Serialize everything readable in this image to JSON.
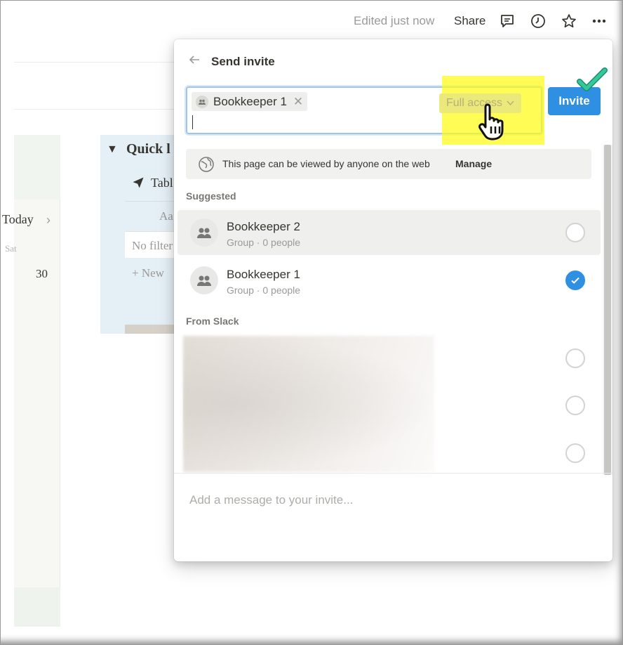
{
  "topbar": {
    "edited_text": "Edited just now",
    "share_label": "Share",
    "icons": [
      "comment-icon",
      "clock-icon",
      "star-icon",
      "more-icon"
    ]
  },
  "background": {
    "calendar": {
      "today_label": "Today",
      "weekday": "Sat",
      "day_number": "30"
    },
    "quick": {
      "title": "Quick l",
      "table_label": "Tabl",
      "property": "Aa",
      "filter_text": "No filter",
      "new_label": "New"
    }
  },
  "popup": {
    "back_icon": "arrow-left-icon",
    "title": "Send invite",
    "chip_label": "Bookkeeper 1",
    "access_label": "Full access",
    "invite_button": "Invite",
    "web_note": "This page can be viewed by anyone on the web",
    "manage_label": "Manage",
    "suggested_label": "Suggested",
    "suggested": [
      {
        "name": "Bookkeeper 2",
        "sub": "Group · 0 people",
        "selected": false
      },
      {
        "name": "Bookkeeper 1",
        "sub": "Group · 0 people",
        "selected": true
      }
    ],
    "from_slack_label": "From Slack",
    "message_placeholder": "Add a message to your invite..."
  },
  "colors": {
    "accent": "#2f8fe3",
    "highlight": "#fffc14",
    "check_annotation": "#27b38a"
  }
}
